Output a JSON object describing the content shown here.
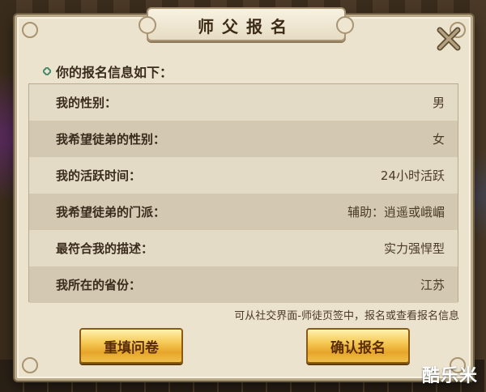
{
  "dialog": {
    "title": "师父报名",
    "heading": "你的报名信息如下：",
    "rows": [
      {
        "label": "我的性别：",
        "value": "男"
      },
      {
        "label": "我希望徒弟的性别：",
        "value": "女"
      },
      {
        "label": "我的活跃时间：",
        "value": "24小时活跃"
      },
      {
        "label": "我希望徒弟的门派：",
        "value": "辅助：逍遥或峨嵋"
      },
      {
        "label": "最符合我的描述：",
        "value": "实力强悍型"
      },
      {
        "label": "我所在的省份：",
        "value": "江苏"
      }
    ],
    "hint": "可从社交界面-师徒页签中，报名或查看报名信息",
    "refill_label": "重填问卷",
    "confirm_label": "确认报名",
    "close_icon": "close-icon"
  },
  "watermark": "酷乐米",
  "colors": {
    "panel": "#ece3cf",
    "row_light": "#e4dbc7",
    "row_dark": "#d3c8b2",
    "button_gold": "#f5c955",
    "text_dark": "#3a2c1c"
  }
}
